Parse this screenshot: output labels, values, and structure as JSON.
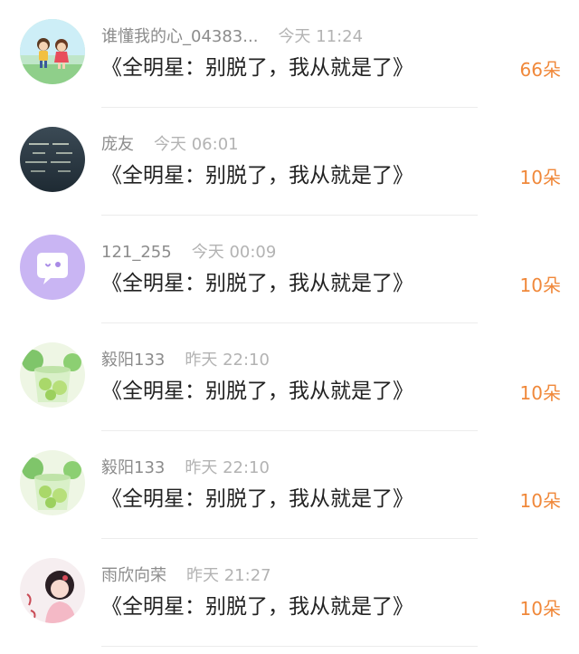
{
  "accent_color": "#f0883a",
  "items": [
    {
      "name": "谁懂我的心_04383...",
      "time": "今天 11:24",
      "title": "《全明星：别脱了，我从就是了》",
      "flowers": "66朵",
      "avatar": "cartoon-couple-avatar"
    },
    {
      "name": "庞友",
      "time": "今天 06:01",
      "title": "《全明星：别脱了，我从就是了》",
      "flowers": "10朵",
      "avatar": "text-night-sky-avatar"
    },
    {
      "name": "121_255",
      "time": "今天 00:09",
      "title": "《全明星：别脱了，我从就是了》",
      "flowers": "10朵",
      "avatar": "purple-chat-bubble-avatar"
    },
    {
      "name": "毅阳133",
      "time": "昨天 22:10",
      "title": "《全明星：别脱了，我从就是了》",
      "flowers": "10朵",
      "avatar": "lime-drink-avatar"
    },
    {
      "name": "毅阳133",
      "time": "昨天 22:10",
      "title": "《全明星：别脱了，我从就是了》",
      "flowers": "10朵",
      "avatar": "lime-drink-avatar"
    },
    {
      "name": "雨欣向荣",
      "time": "昨天 21:27",
      "title": "《全明星：别脱了，我从就是了》",
      "flowers": "10朵",
      "avatar": "girl-portrait-avatar"
    }
  ]
}
